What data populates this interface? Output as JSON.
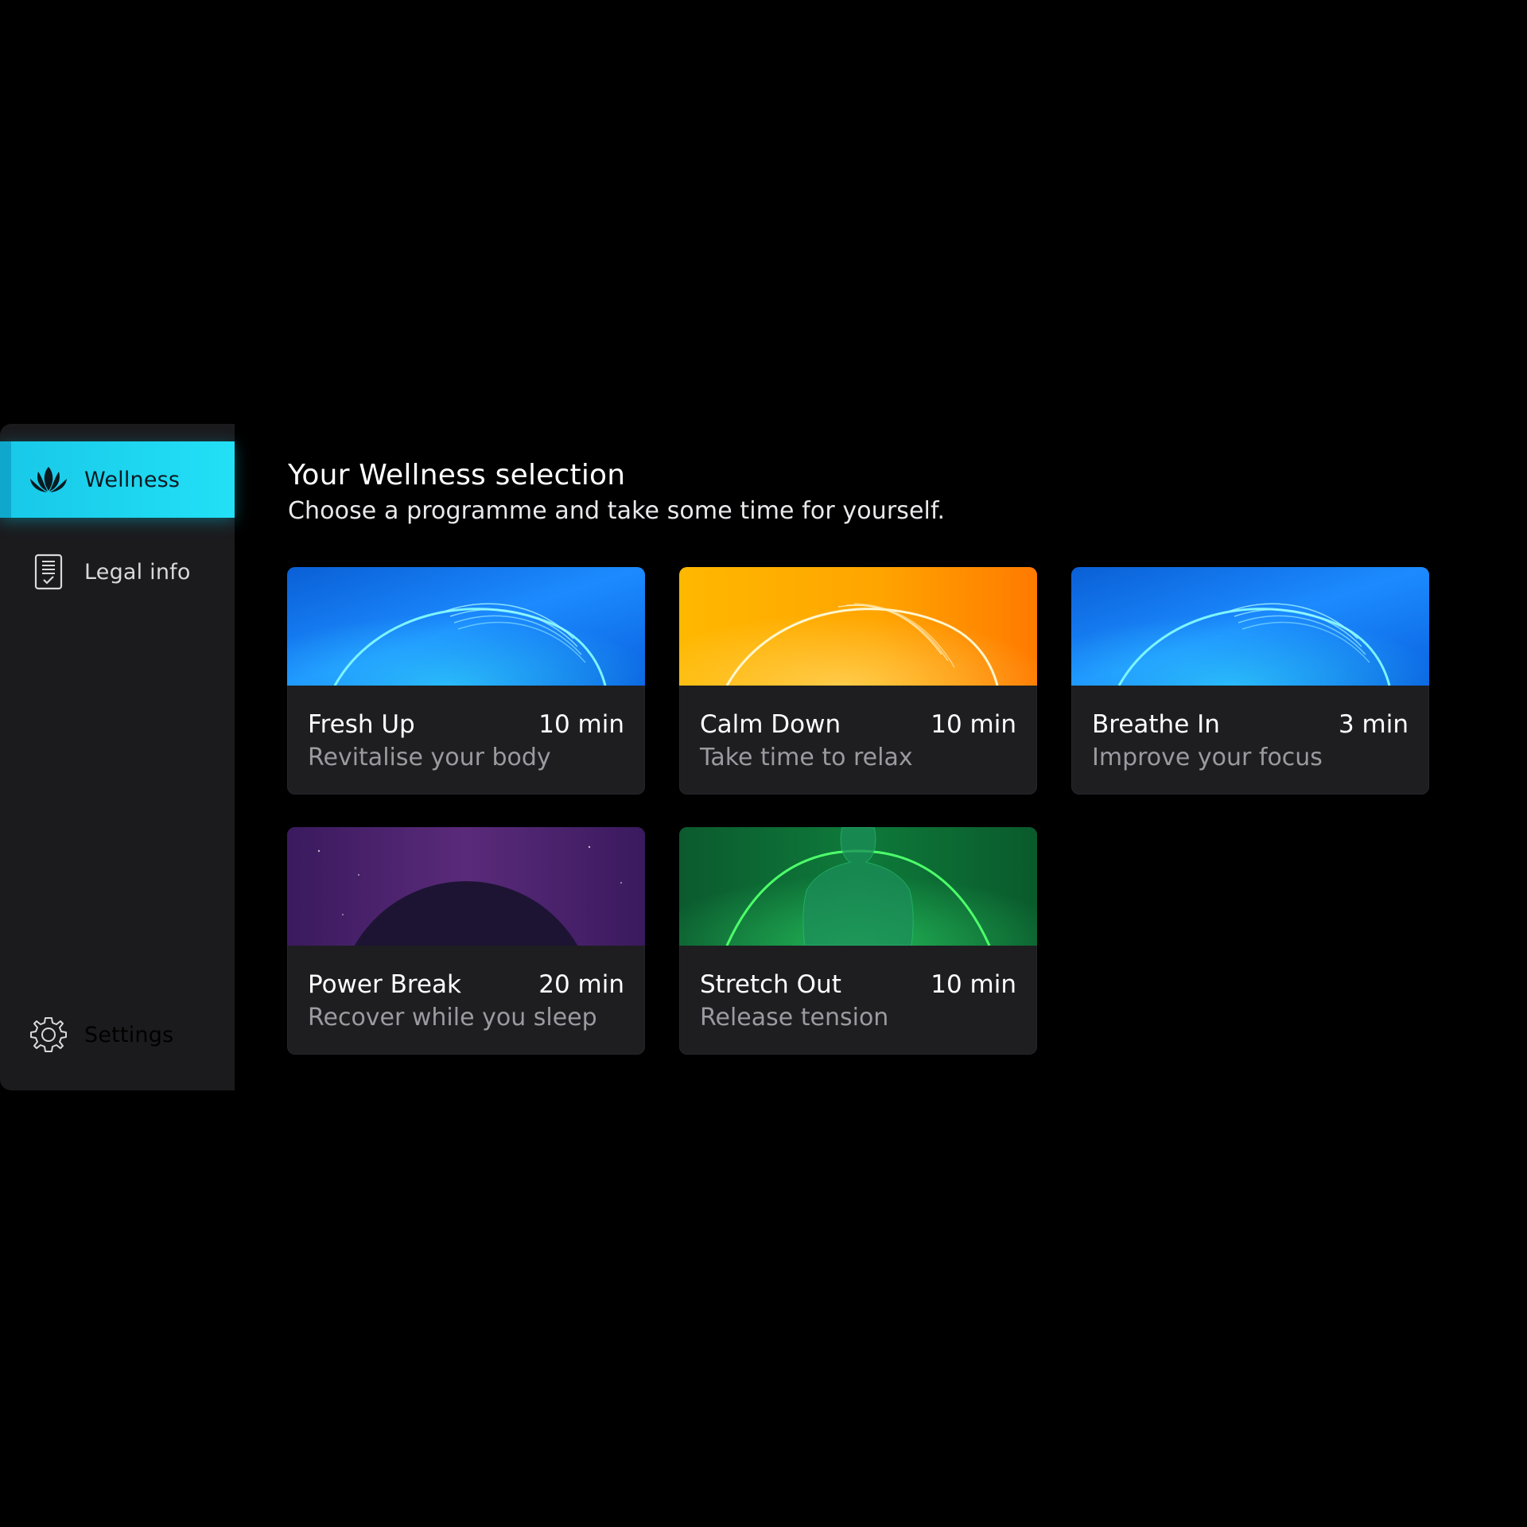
{
  "sidebar": {
    "items": [
      {
        "label": "Wellness",
        "icon": "lotus-icon",
        "active": true
      },
      {
        "label": "Legal info",
        "icon": "document-check-icon",
        "active": false
      }
    ],
    "settings": {
      "label": "Settings",
      "icon": "gear-icon"
    }
  },
  "header": {
    "title": "Your Wellness selection",
    "subtitle": "Choose a programme and take some time for yourself."
  },
  "programmes": [
    {
      "title": "Fresh Up",
      "duration": "10 min",
      "description": "Revitalise your body",
      "theme": "blue",
      "accent": "#1f86ff"
    },
    {
      "title": "Calm Down",
      "duration": "10 min",
      "description": "Take time to relax",
      "theme": "orange",
      "accent": "#ffa300"
    },
    {
      "title": "Breathe In",
      "duration": "3 min",
      "description": "Improve your focus",
      "theme": "blue",
      "accent": "#1f86ff"
    },
    {
      "title": "Power Break",
      "duration": "20 min",
      "description": "Recover while you sleep",
      "theme": "eclipse",
      "accent": "#7a2f8c"
    },
    {
      "title": "Stretch Out",
      "duration": "10 min",
      "description": "Release tension",
      "theme": "green",
      "accent": "#0e7a3a"
    }
  ],
  "colors": {
    "active_nav": "#22e0f6",
    "sidebar_bg": "#1b1b1e",
    "card_bg": "#1e1e21"
  }
}
